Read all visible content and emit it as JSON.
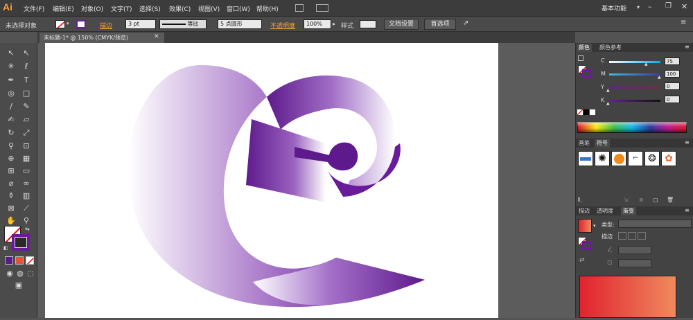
{
  "app": {
    "logo": "Ai"
  },
  "menu": [
    "文件(F)",
    "编辑(E)",
    "对象(O)",
    "文字(T)",
    "选择(S)",
    "效果(C)",
    "视图(V)",
    "窗口(W)",
    "帮助(H)"
  ],
  "workspace": {
    "label": "基本功能"
  },
  "control": {
    "selection_label": "未选择对象",
    "stroke_label": "描边",
    "stroke_value": "3 pt",
    "profile_label": "等比",
    "brush_value": "5 点圆形",
    "opacity_label": "不透明度",
    "opacity_value": "100%",
    "style_label": "样式",
    "doc_setup_label": "文档设置",
    "prefs_label": "首选项"
  },
  "document": {
    "tab_title": "未标题-1* @ 150% (CMYK/预览)"
  },
  "panels": {
    "color": {
      "tabs": [
        "颜色",
        "颜色参考"
      ],
      "channels": [
        {
          "name": "C",
          "value": "75"
        },
        {
          "name": "M",
          "value": "100"
        },
        {
          "name": "Y",
          "value": "0"
        },
        {
          "name": "K",
          "value": "0"
        }
      ]
    },
    "symbols": {
      "tabs": [
        "画笔",
        "符号"
      ]
    },
    "gradient": {
      "tabs": [
        "描边",
        "透明度",
        "渐变"
      ],
      "type_label": "类型:",
      "stroke_label": "描边"
    }
  },
  "colors": {
    "accent_purple": "#6a1b9a",
    "fill_purple": "#5e1a8c",
    "gradient_start": "#e0232f",
    "gradient_end": "#f08a5d"
  }
}
